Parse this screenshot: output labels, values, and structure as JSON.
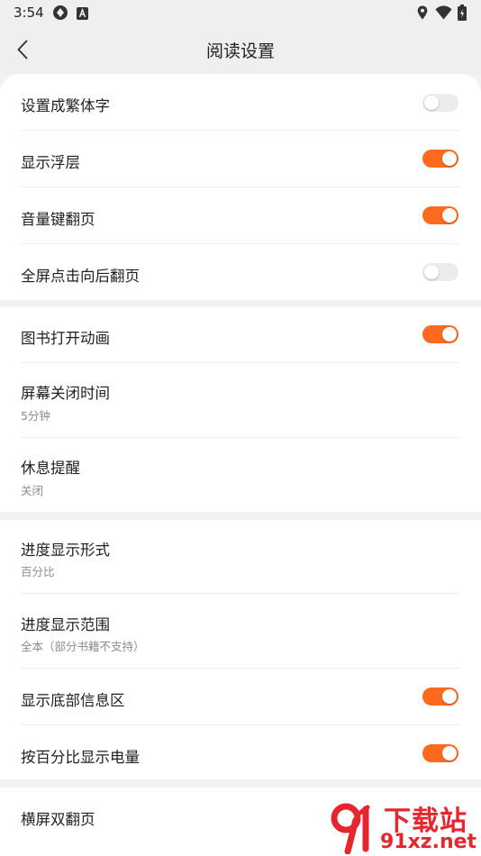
{
  "status_bar": {
    "time": "3:54"
  },
  "header": {
    "title": "阅读设置"
  },
  "section1": {
    "items": [
      {
        "label": "设置成繁体字",
        "on": false
      },
      {
        "label": "显示浮层",
        "on": true
      },
      {
        "label": "音量键翻页",
        "on": true
      },
      {
        "label": "全屏点击向后翻页",
        "on": false
      }
    ]
  },
  "section2": {
    "anim": {
      "label": "图书打开动画",
      "on": true
    },
    "screen_off": {
      "label": "屏幕关闭时间",
      "value": "5分钟"
    },
    "rest": {
      "label": "休息提醒",
      "value": "关闭"
    }
  },
  "section3": {
    "progress_form": {
      "label": "进度显示形式",
      "value": "百分比"
    },
    "progress_range": {
      "label": "进度显示范围",
      "value": "全本（部分书籍不支持）"
    },
    "bottom_info": {
      "label": "显示底部信息区",
      "on": true
    },
    "battery_pct": {
      "label": "按百分比显示电量",
      "on": true
    }
  },
  "section4": {
    "landscape": {
      "label": "横屏双翻页"
    }
  },
  "watermark": {
    "line1": "下载站",
    "line2": "91xz.net"
  },
  "colors": {
    "accent": "#ff6a1f",
    "toggle_off": "#ececec",
    "background": "#f2f2f2"
  }
}
